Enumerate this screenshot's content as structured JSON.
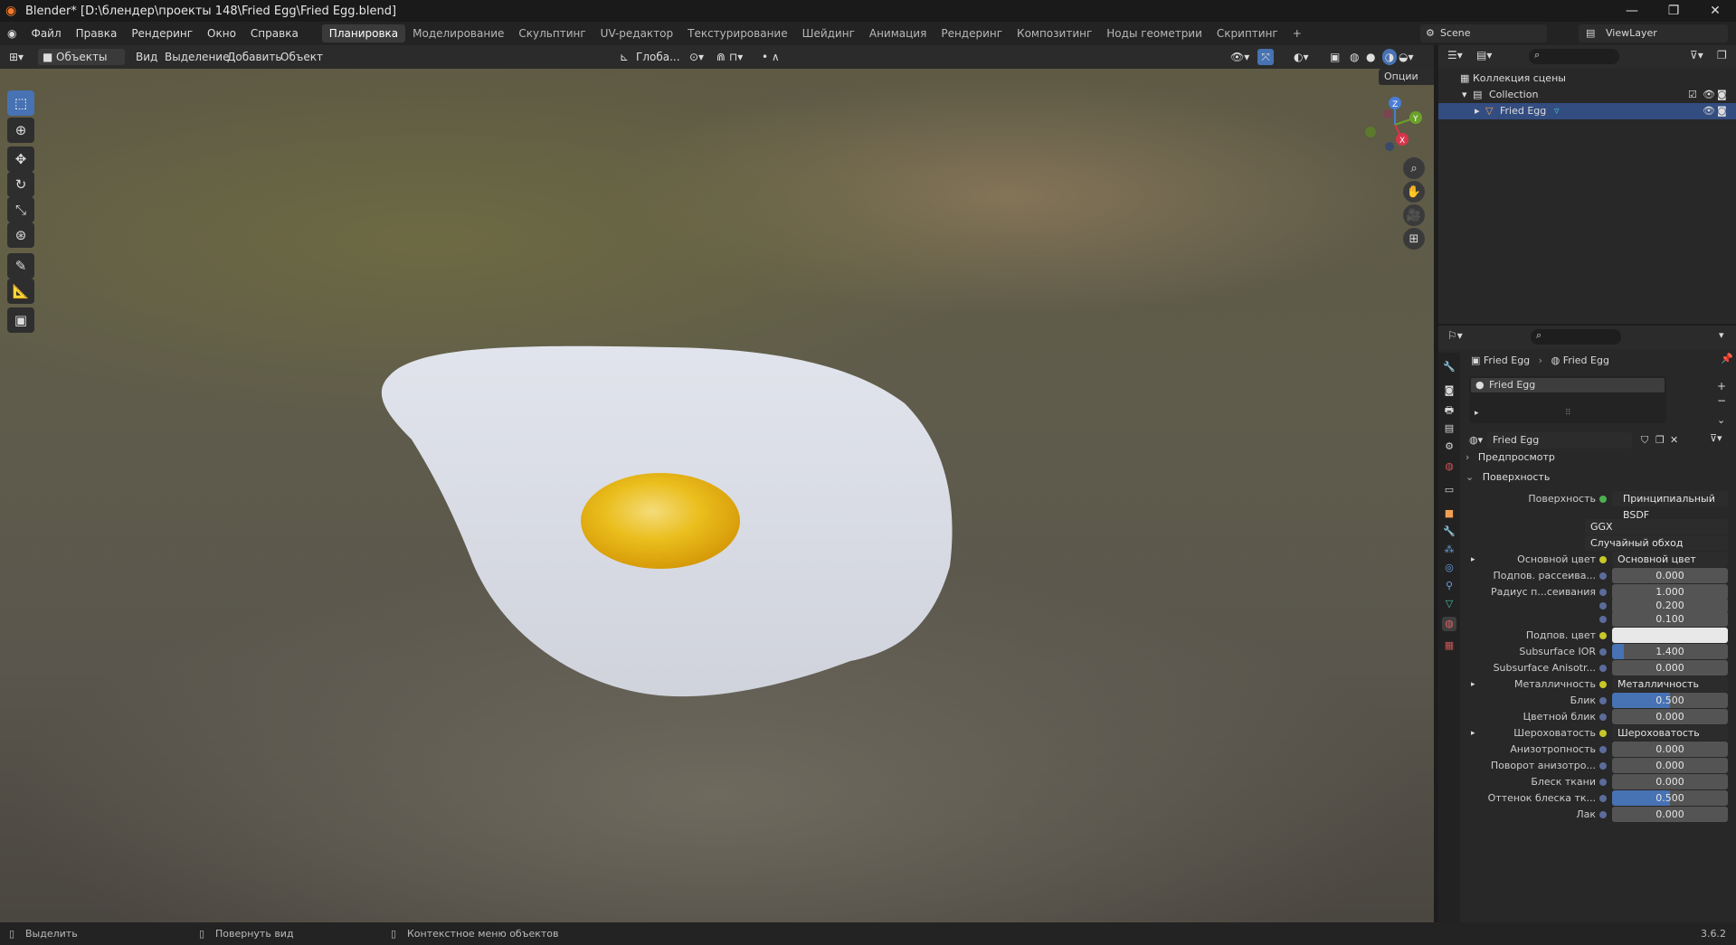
{
  "title": "Blender* [D:\\блендер\\проекты 148\\Fried Egg\\Fried Egg.blend]",
  "menus": [
    "Файл",
    "Правка",
    "Рендеринг",
    "Окно",
    "Справка"
  ],
  "workspaces": [
    "Планировка",
    "Моделирование",
    "Скульптинг",
    "UV-редактор",
    "Текстурирование",
    "Шейдинг",
    "Анимация",
    "Рендеринг",
    "Композитинг",
    "Ноды геометрии",
    "Скриптинг"
  ],
  "scene": "Scene",
  "viewlayer": "ViewLayer",
  "viewport_header": {
    "mode": "Объекты",
    "menus": [
      "Вид",
      "Выделение",
      "Добавить",
      "Объект"
    ],
    "transform": "Глоба...",
    "options": "Опции"
  },
  "outliner": {
    "root": "Коллекция сцены",
    "collection": "Collection",
    "object": "Fried Egg"
  },
  "properties": {
    "breadcrumb": [
      "Fried Egg",
      "Fried Egg"
    ],
    "slot": "Fried Egg",
    "material": "Fried Egg",
    "panels": {
      "preview": "Предпросмотр",
      "surface": "Поверхность"
    },
    "surface_label": "Поверхность",
    "surface_value": "Принципиальный BSDF",
    "distribution": "GGX",
    "subsurface_method": "Случайный обход",
    "rows": [
      {
        "label": "Основной цвет",
        "value": "Основной цвет",
        "kind": "link"
      },
      {
        "label": "Подпов. рассеива...",
        "value": "0.000",
        "kind": "num"
      },
      {
        "label": "Радиус п...сеивания",
        "value": "1.000",
        "kind": "num"
      },
      {
        "label": "",
        "value": "0.200",
        "kind": "num"
      },
      {
        "label": "",
        "value": "0.100",
        "kind": "num"
      },
      {
        "label": "Подпов. цвет",
        "value": "",
        "kind": "color"
      },
      {
        "label": "Subsurface IOR",
        "value": "1.400",
        "kind": "num"
      },
      {
        "label": "Subsurface Anisotr...",
        "value": "0.000",
        "kind": "num"
      },
      {
        "label": "Металличность",
        "value": "Металличность",
        "kind": "link"
      },
      {
        "label": "Блик",
        "value": "0.500",
        "kind": "blue"
      },
      {
        "label": "Цветной блик",
        "value": "0.000",
        "kind": "num"
      },
      {
        "label": "Шероховатость",
        "value": "Шероховатость",
        "kind": "link"
      },
      {
        "label": "Анизотропность",
        "value": "0.000",
        "kind": "num"
      },
      {
        "label": "Поворот анизотро...",
        "value": "0.000",
        "kind": "num"
      },
      {
        "label": "Блеск ткани",
        "value": "0.000",
        "kind": "num"
      },
      {
        "label": "Оттенок блеска тк...",
        "value": "0.500",
        "kind": "blue"
      },
      {
        "label": "Лак",
        "value": "0.000",
        "kind": "num"
      }
    ]
  },
  "status": {
    "select": "Выделить",
    "rotate": "Повернуть вид",
    "context": "Контекстное меню объектов",
    "version": "3.6.2"
  },
  "colors": {
    "accent": "#4772b3",
    "egg_white": "#d7dbe4",
    "yolk": "#e8b412"
  }
}
